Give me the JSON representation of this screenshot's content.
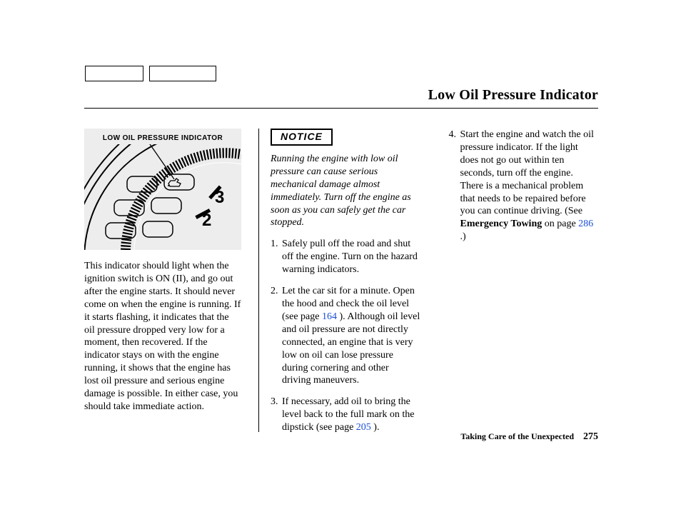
{
  "title": "Low Oil Pressure Indicator",
  "diagram": {
    "label": "LOW OIL PRESSURE INDICATOR",
    "tick_major_1": "3",
    "tick_major_2": "2"
  },
  "col1": {
    "p1": "This indicator should light when the ignition switch is ON (II), and go out after the engine starts. It should never come on when the engine is running. If it starts flashing, it indicates that the oil pressure dropped very low for a moment, then recovered. If the indicator stays on with the engine running, it shows that the engine has lost oil pressure and serious engine damage is possible. In either case, you should take immediate action."
  },
  "col2": {
    "notice": "NOTICE",
    "warning": "Running the engine with low oil pressure can cause serious mechanical damage almost immediately. Turn off the engine as soon as you can safely get the car stopped.",
    "steps": [
      {
        "n": "1.",
        "text": "Safely pull off the road and shut off the engine. Turn on the hazard warning indicators."
      },
      {
        "n": "2.",
        "pre": "Let the car sit for a minute. Open the hood and check the oil level (see page ",
        "link": "164",
        "post": " ). Although oil level and oil pressure are not directly connected, an engine that is very low on oil can lose pressure during cornering and other driving maneuvers."
      },
      {
        "n": "3.",
        "pre": "If necessary, add oil to bring the level back to the full mark on the dipstick (see page ",
        "link": "205",
        "post": " )."
      }
    ]
  },
  "col3": {
    "step4": {
      "n": "4.",
      "pre": "Start the engine and watch the oil pressure indicator. If the light does not go out within ten seconds, turn off the engine. There is a mechanical problem that needs to be repaired before you can continue driving. (See ",
      "bold": "Emergency Towing",
      "mid": " on page ",
      "link": "286",
      "post": " .)"
    }
  },
  "footer": {
    "section": "Taking Care of the Unexpected",
    "page": "275"
  }
}
